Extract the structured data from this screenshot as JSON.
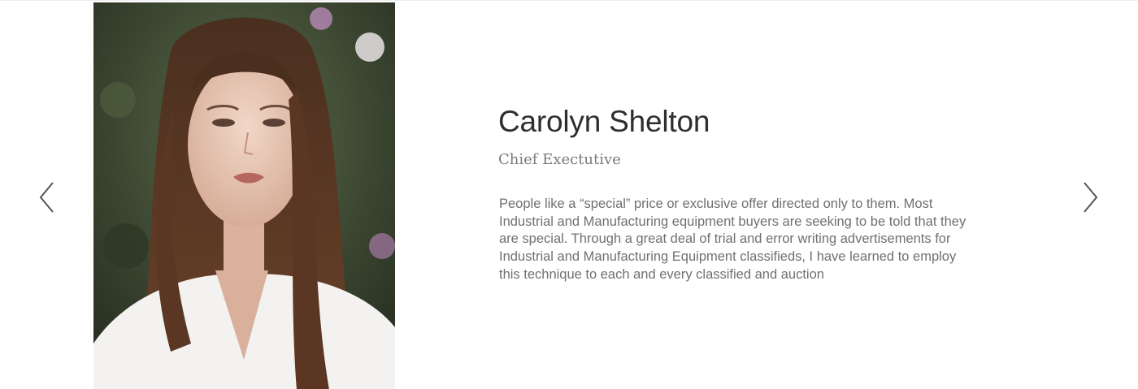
{
  "slider": {
    "prev_icon": "chevron-left-icon",
    "next_icon": "chevron-right-icon",
    "arrow_color": "#555555"
  },
  "person": {
    "photo": "portrait-photo",
    "name": "Carolyn Shelton",
    "title": "Chief Exectutive",
    "bio": "People like a “special” price or exclusive offer directed only to them. Most Industrial and Manufacturing equipment buyers are seeking to be told that they are special. Through a great deal of trial and error writing advertisements for Industrial and Manufacturing Equipment classifieds, I have learned to employ this technique to each and every classified and auction"
  }
}
